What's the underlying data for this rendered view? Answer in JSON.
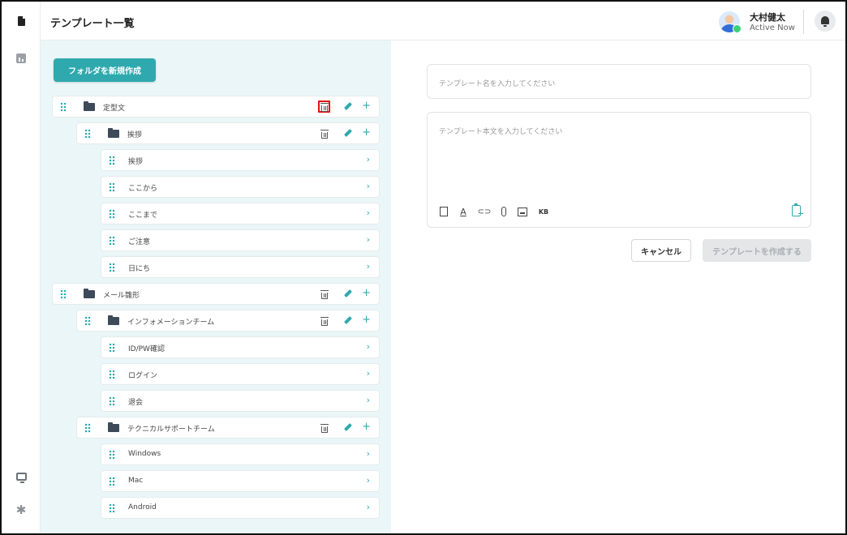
{
  "header": {
    "title": "テンプレート一覧",
    "user": {
      "name": "大村健太",
      "status": "Active Now"
    }
  },
  "tree": {
    "new_folder_label": "フォルダを新規作成",
    "nodes": [
      {
        "label": "定型文",
        "type": "folder",
        "level": 0
      },
      {
        "label": "挨拶",
        "type": "folder",
        "level": 1
      },
      {
        "label": "挨拶",
        "type": "template",
        "level": 2
      },
      {
        "label": "ここから",
        "type": "template",
        "level": 2
      },
      {
        "label": "ここまで",
        "type": "template",
        "level": 2
      },
      {
        "label": "ご注意",
        "type": "template",
        "level": 2
      },
      {
        "label": "日にち",
        "type": "template",
        "level": 2
      },
      {
        "label": "メール雛形",
        "type": "folder",
        "level": 0
      },
      {
        "label": "インフォメーションチーム",
        "type": "folder",
        "level": 1
      },
      {
        "label": "ID/PW確認",
        "type": "template",
        "level": 2
      },
      {
        "label": "ログイン",
        "type": "template",
        "level": 2
      },
      {
        "label": "退会",
        "type": "template",
        "level": 2
      },
      {
        "label": "テクニカルサポートチーム",
        "type": "folder",
        "level": 1
      },
      {
        "label": "Windows",
        "type": "template",
        "level": 2
      },
      {
        "label": "Mac",
        "type": "template",
        "level": 2
      },
      {
        "label": "Android",
        "type": "template",
        "level": 2
      }
    ]
  },
  "form": {
    "name_placeholder": "テンプレート名を入力してください",
    "body_placeholder": "テンプレート本文を入力してください",
    "toolbar": {
      "font_glyph": "A",
      "link_glyph": "⊂⊃",
      "kb_label": "KB"
    },
    "cancel_label": "キャンセル",
    "create_label": "テンプレートを作成する"
  },
  "glyphs": {
    "add": "+",
    "chevron": "›",
    "gear": "✱"
  },
  "colors": {
    "accent": "#2fa9ae",
    "panel_bg": "#eaf6f7",
    "highlight": "#e01010"
  }
}
